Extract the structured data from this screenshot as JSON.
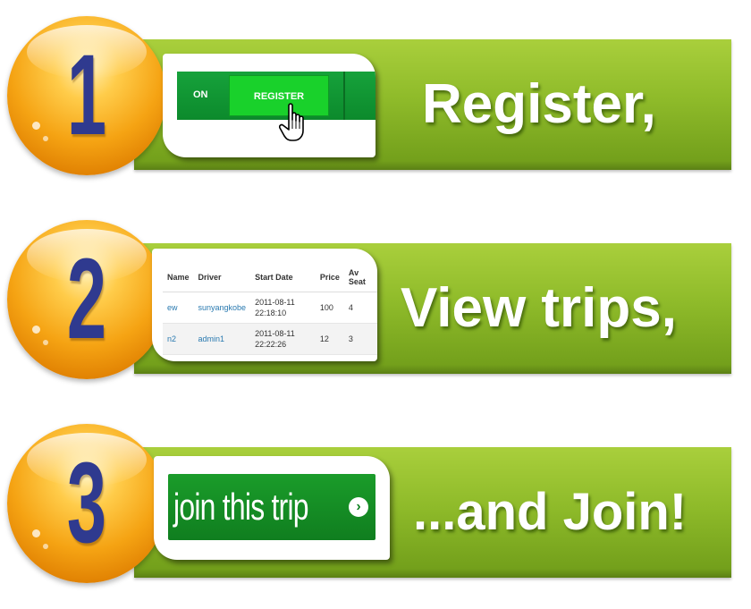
{
  "colors": {
    "banner_green": "#8fbb2a",
    "circle_orange": "#f5a313",
    "number_navy": "#2f3a8f",
    "nav_green": "#16a23b",
    "link_blue": "#2a7ab0"
  },
  "steps": [
    {
      "number": "1",
      "label": "Register,",
      "snippet": {
        "nav_partial": "ON",
        "register_button": "REGISTER",
        "cursor_icon": "hand-pointer-icon"
      }
    },
    {
      "number": "2",
      "label": "View trips,",
      "snippet": {
        "headers": [
          "Name",
          "Driver",
          "Start Date",
          "Price",
          "Av Seat"
        ],
        "rows": [
          [
            "ew",
            "sunyangkobe",
            "2011-08-11 22:18:10",
            "100",
            "4"
          ],
          [
            "n2",
            "admin1",
            "2011-08-11 22:22:26",
            "12",
            "3"
          ]
        ]
      }
    },
    {
      "number": "3",
      "label": "...and Join!",
      "snippet": {
        "join_button": "join this trip",
        "arrow_icon": "chevron-right-circle-icon"
      }
    }
  ]
}
